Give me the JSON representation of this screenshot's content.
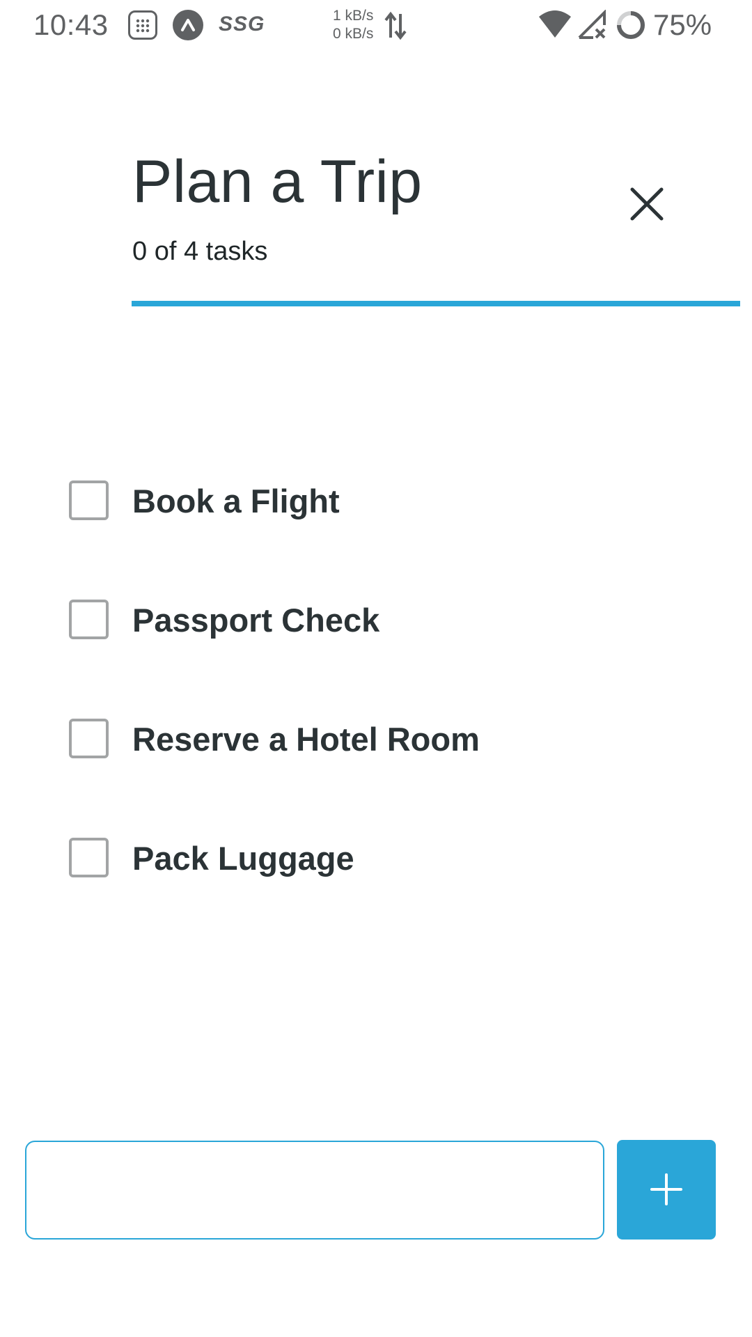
{
  "status_bar": {
    "time": "10:43",
    "app_icons": [
      "calculator-icon",
      "alert-circle-icon"
    ],
    "ssg_label": "SSG",
    "speed_up": "1 kB/s",
    "speed_down": "0 kB/s",
    "battery": "75%"
  },
  "header": {
    "title": "Plan a Trip",
    "subtitle": "0 of 4 tasks",
    "progress_fraction": 0
  },
  "tasks": [
    {
      "label": "Book a Flight",
      "checked": false
    },
    {
      "label": "Passport Check",
      "checked": false
    },
    {
      "label": "Reserve a Hotel Room",
      "checked": false
    },
    {
      "label": "Pack Luggage",
      "checked": false
    }
  ],
  "new_task": {
    "value": "",
    "placeholder": ""
  },
  "colors": {
    "accent": "#2aa6d8",
    "text": "#2b3336",
    "checkbox_border": "#a2a4a5",
    "status_text": "#5f6163"
  }
}
